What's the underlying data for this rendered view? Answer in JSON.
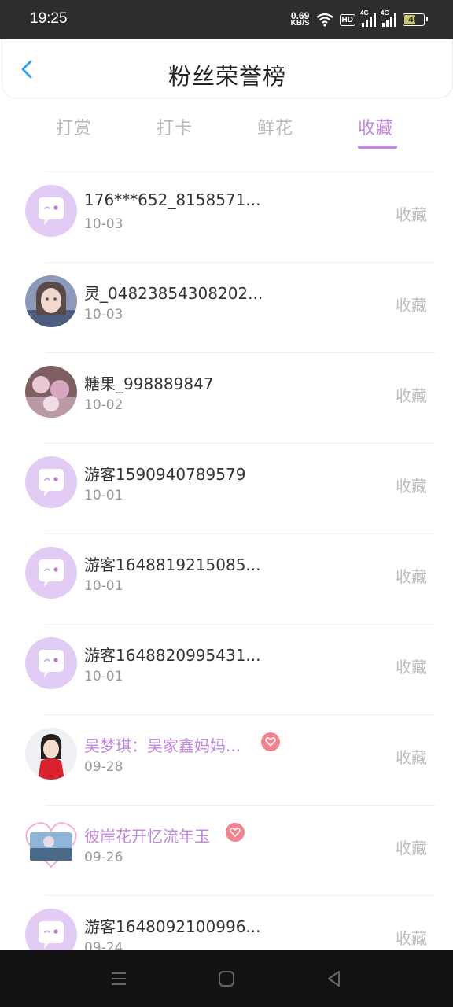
{
  "status": {
    "time": "19:25",
    "speed_value": "0.69",
    "speed_unit": "KB/S",
    "hd": "HD",
    "net1": "4G",
    "net2": "4G",
    "battery": "49"
  },
  "header": {
    "title": "粉丝荣誉榜"
  },
  "tabs": [
    {
      "label": "打赏"
    },
    {
      "label": "打卡"
    },
    {
      "label": "鲜花"
    },
    {
      "label": "收藏"
    }
  ],
  "active_tab": "收藏",
  "colors": {
    "accent": "#c188dd",
    "badge": "#f0838f",
    "avatar_default": "#e2ccf5"
  },
  "fans": [
    {
      "name": "176***652_8158571...",
      "date": "10-03",
      "action": "收藏",
      "avatar": "chat-bubble-avatar",
      "vip": false
    },
    {
      "name": "灵_04823854308202...",
      "date": "10-03",
      "action": "收藏",
      "avatar": "photo-avatar",
      "vip": false
    },
    {
      "name": "糖果_998889847",
      "date": "10-02",
      "action": "收藏",
      "avatar": "photo-avatar",
      "vip": false
    },
    {
      "name": "游客1590940789579",
      "date": "10-01",
      "action": "收藏",
      "avatar": "chat-bubble-avatar",
      "vip": false
    },
    {
      "name": "游客1648819215085...",
      "date": "10-01",
      "action": "收藏",
      "avatar": "chat-bubble-avatar",
      "vip": false
    },
    {
      "name": "游客1648820995431...",
      "date": "10-01",
      "action": "收藏",
      "avatar": "chat-bubble-avatar",
      "vip": false
    },
    {
      "name": "吴梦琪：吴家鑫妈妈...",
      "date": "09-28",
      "action": "收藏",
      "avatar": "photo-avatar",
      "vip": true
    },
    {
      "name": "彼岸花开忆流年玉",
      "date": "09-26",
      "action": "收藏",
      "avatar": "photo-avatar",
      "vip": true
    },
    {
      "name": "游客1648092100996...",
      "date": "09-24",
      "action": "收藏",
      "avatar": "chat-bubble-avatar",
      "vip": false
    }
  ]
}
